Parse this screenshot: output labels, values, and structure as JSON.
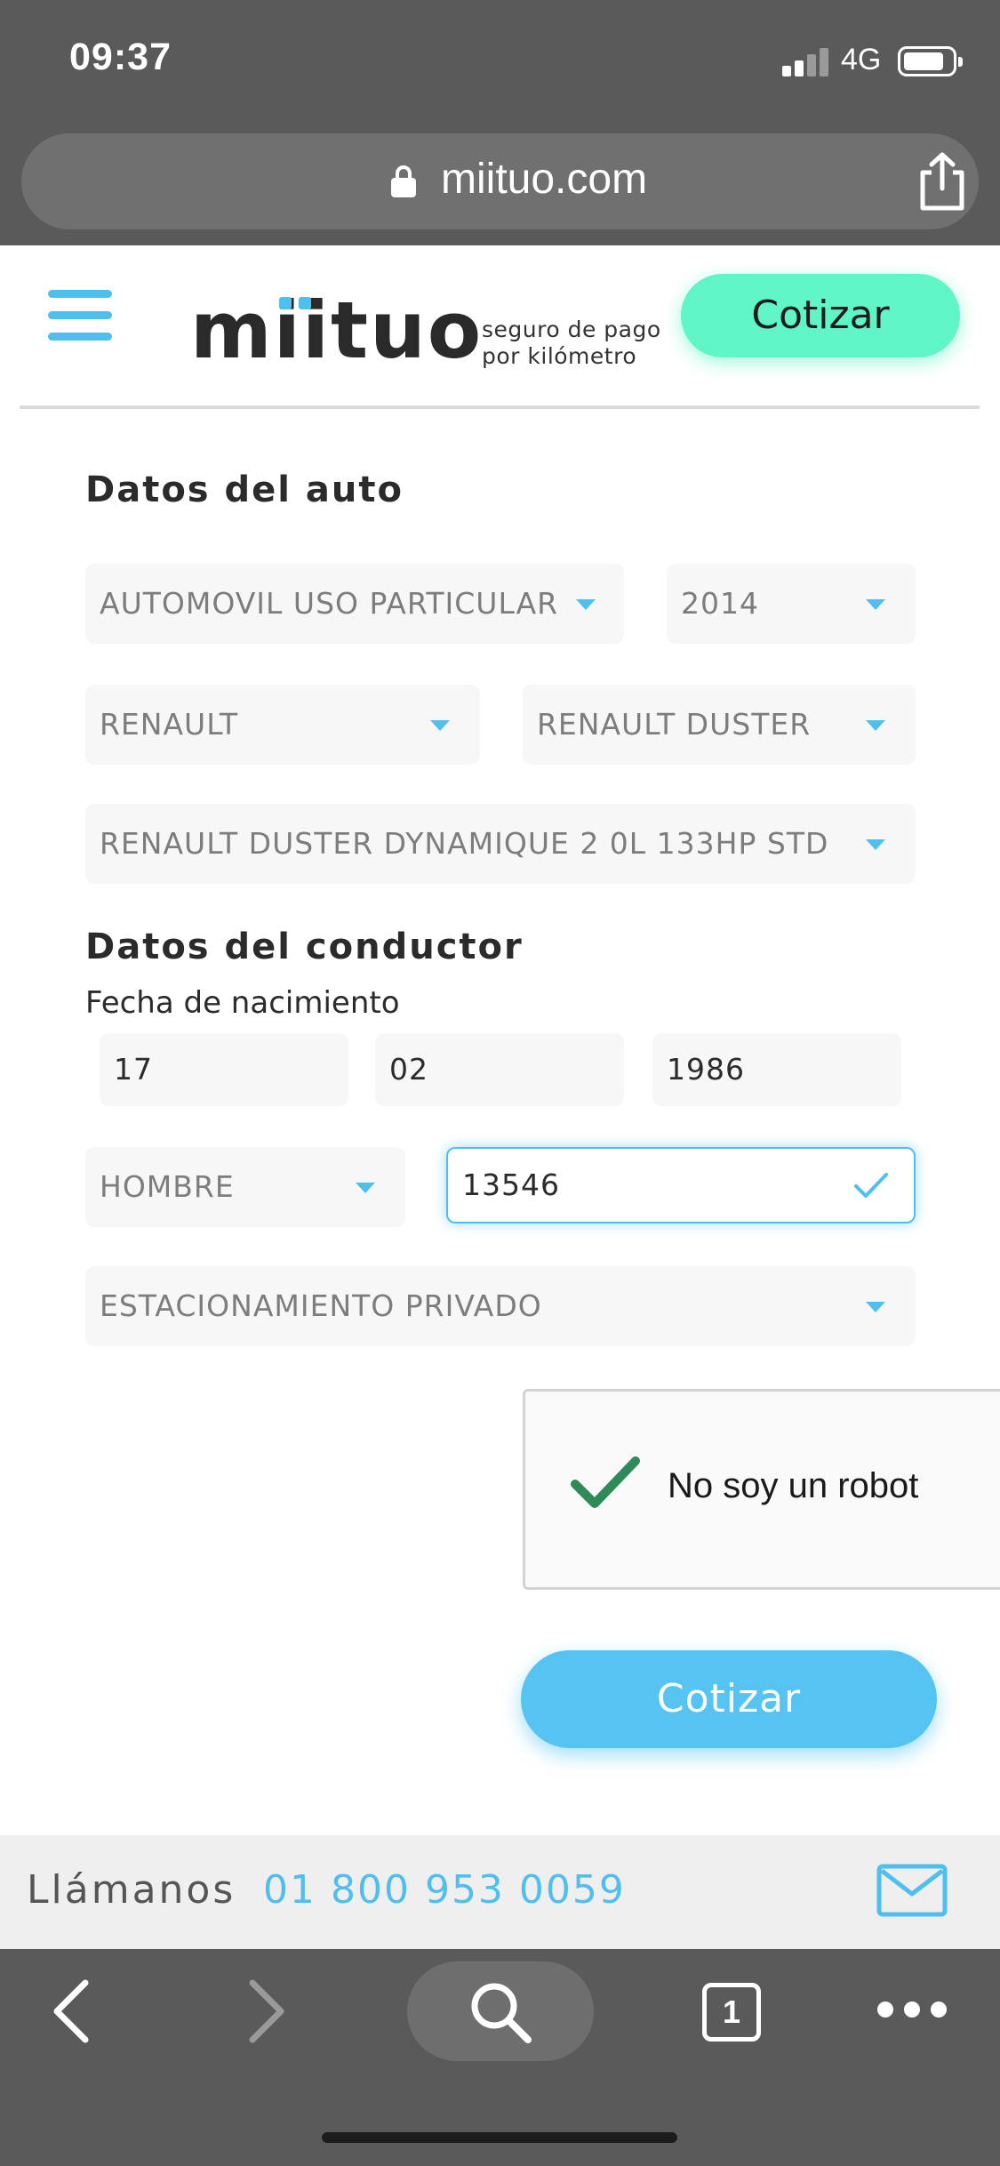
{
  "status_bar": {
    "time": "09:37",
    "network": "4G"
  },
  "browser": {
    "url": "miituo.com",
    "tab_count": "1"
  },
  "header": {
    "logo_text": "miituo",
    "tagline_line1": "seguro de pago",
    "tagline_line2": "por kilómetro",
    "cta_label": "Cotizar"
  },
  "form": {
    "car_section_title": "Datos del auto",
    "vehicle_type": "AUTOMOVIL USO PARTICULAR",
    "year": "2014",
    "brand": "RENAULT",
    "model": "RENAULT DUSTER",
    "version": "RENAULT DUSTER DYNAMIQUE 2 0L 133HP STD",
    "driver_section_title": "Datos del conductor",
    "birthdate_label": "Fecha de nacimiento",
    "birth_day": "17",
    "birth_month": "02",
    "birth_year": "1986",
    "gender": "HOMBRE",
    "postal_code": "13546",
    "parking": "ESTACIONAMIENTO PRIVADO",
    "captcha_label": "No soy un robot",
    "submit_label": "Cotizar"
  },
  "contact": {
    "call_label": "Llámanos",
    "phone": "01 800 953 0059"
  },
  "colors": {
    "accent_blue": "#4fbfef",
    "cta_green": "#5ff5c6",
    "captcha_green": "#2e8b57"
  }
}
